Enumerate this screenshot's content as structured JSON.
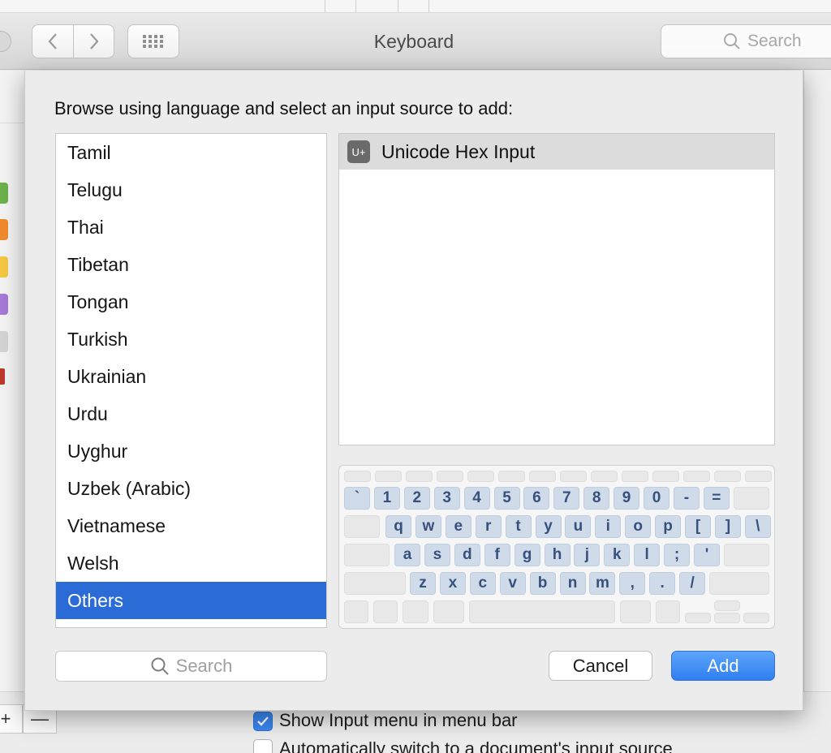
{
  "window": {
    "title": "Keyboard",
    "search_placeholder": "Search"
  },
  "sheet": {
    "prompt": "Browse using language and select an input source to add:",
    "languages": [
      "Tamil",
      "Telugu",
      "Thai",
      "Tibetan",
      "Tongan",
      "Turkish",
      "Ukrainian",
      "Urdu",
      "Uyghur",
      "Uzbek (Arabic)",
      "Vietnamese",
      "Welsh",
      "Others"
    ],
    "selected_language": "Others",
    "input_sources": [
      {
        "icon_text": "U+",
        "label": "Unicode Hex Input"
      }
    ],
    "search_placeholder": "Search",
    "cancel_label": "Cancel",
    "add_label": "Add"
  },
  "keyboard": {
    "row1": [
      "`",
      "1",
      "2",
      "3",
      "4",
      "5",
      "6",
      "7",
      "8",
      "9",
      "0",
      "-",
      "="
    ],
    "row2": [
      "q",
      "w",
      "e",
      "r",
      "t",
      "y",
      "u",
      "i",
      "o",
      "p",
      "[",
      "]",
      "\\"
    ],
    "row3": [
      "a",
      "s",
      "d",
      "f",
      "g",
      "h",
      "j",
      "k",
      "l",
      ";",
      "'"
    ],
    "row4": [
      "z",
      "x",
      "c",
      "v",
      "b",
      "n",
      "m",
      ",",
      ".",
      "/"
    ]
  },
  "background": {
    "show_input_menu_label": "Show Input menu in menu bar",
    "show_input_menu_checked": true,
    "auto_switch_label": "Automatically switch to a document's input source",
    "auto_switch_checked": false,
    "minus_label": "—"
  },
  "colors": {
    "accent": "#2b6bd6",
    "add_button": "#3a86f2",
    "key_fill": "#d0dbea",
    "key_text": "#37507d"
  }
}
